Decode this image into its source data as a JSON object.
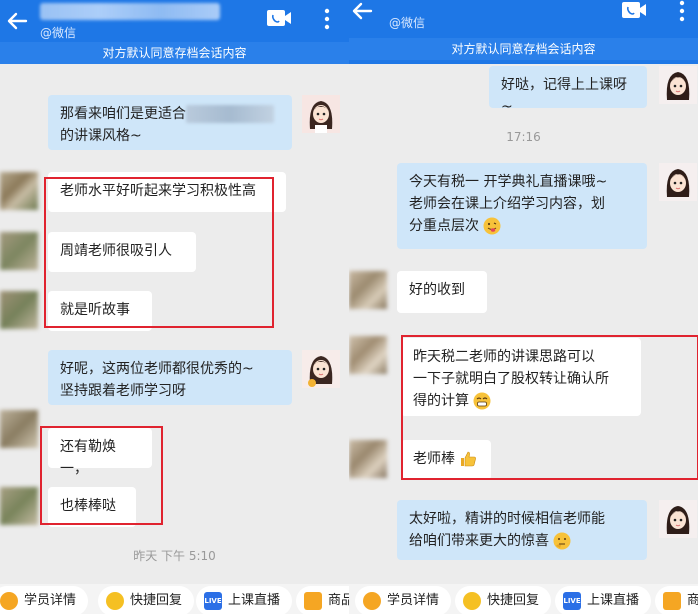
{
  "left": {
    "subtitle": "@微信",
    "notice": "对方默认同意存档会话内容",
    "msg1_line1": "那看来咱们是更适合",
    "msg1_line2": "的讲课风格~",
    "msg2": "老师水平好听起来学习积极性高",
    "msg3": "周靖老师很吸引人",
    "msg4": "就是听故事",
    "msg5_line1": "好呢，这两位老师都很优秀的~",
    "msg5_line2": "坚持跟着老师学习呀",
    "msg6": "还有勒焕一，",
    "msg7": "也棒棒哒",
    "timestamp": "昨天 下午 5:10",
    "chips": [
      "学员详情",
      "快捷回复",
      "上课直播",
      "商品"
    ]
  },
  "right": {
    "subtitle": "@微信",
    "notice": "对方默认同意存档会话内容",
    "msg1": "好哒，记得上上课呀~",
    "timestamp": "17:16",
    "msg2_line1": "今天有税一 开学典礼直播课哦~",
    "msg2_line2": "老师会在课上介绍学习内容，划",
    "msg2_line3": "分重点层次",
    "msg3": "好的收到",
    "msg4_line1": "昨天税二老师的讲课思路可以",
    "msg4_line2": "一下子就明白了股权转让确认所",
    "msg4_line3": "得的计算",
    "msg5": "老师棒",
    "msg6_line1": "太好啦，精讲的时候相信老师能",
    "msg6_line2": "给咱们带来更大的惊喜",
    "chips": [
      "学员详情",
      "快捷回复",
      "上课直播",
      "商品"
    ]
  },
  "live_badge": "LIVE",
  "colors": {
    "titlebar": "#1e77e6",
    "my_bubble": "#cfe6f9",
    "their_bubble": "#ffffff",
    "highlight": "#e0232f",
    "chat_bg": "#ececec"
  }
}
